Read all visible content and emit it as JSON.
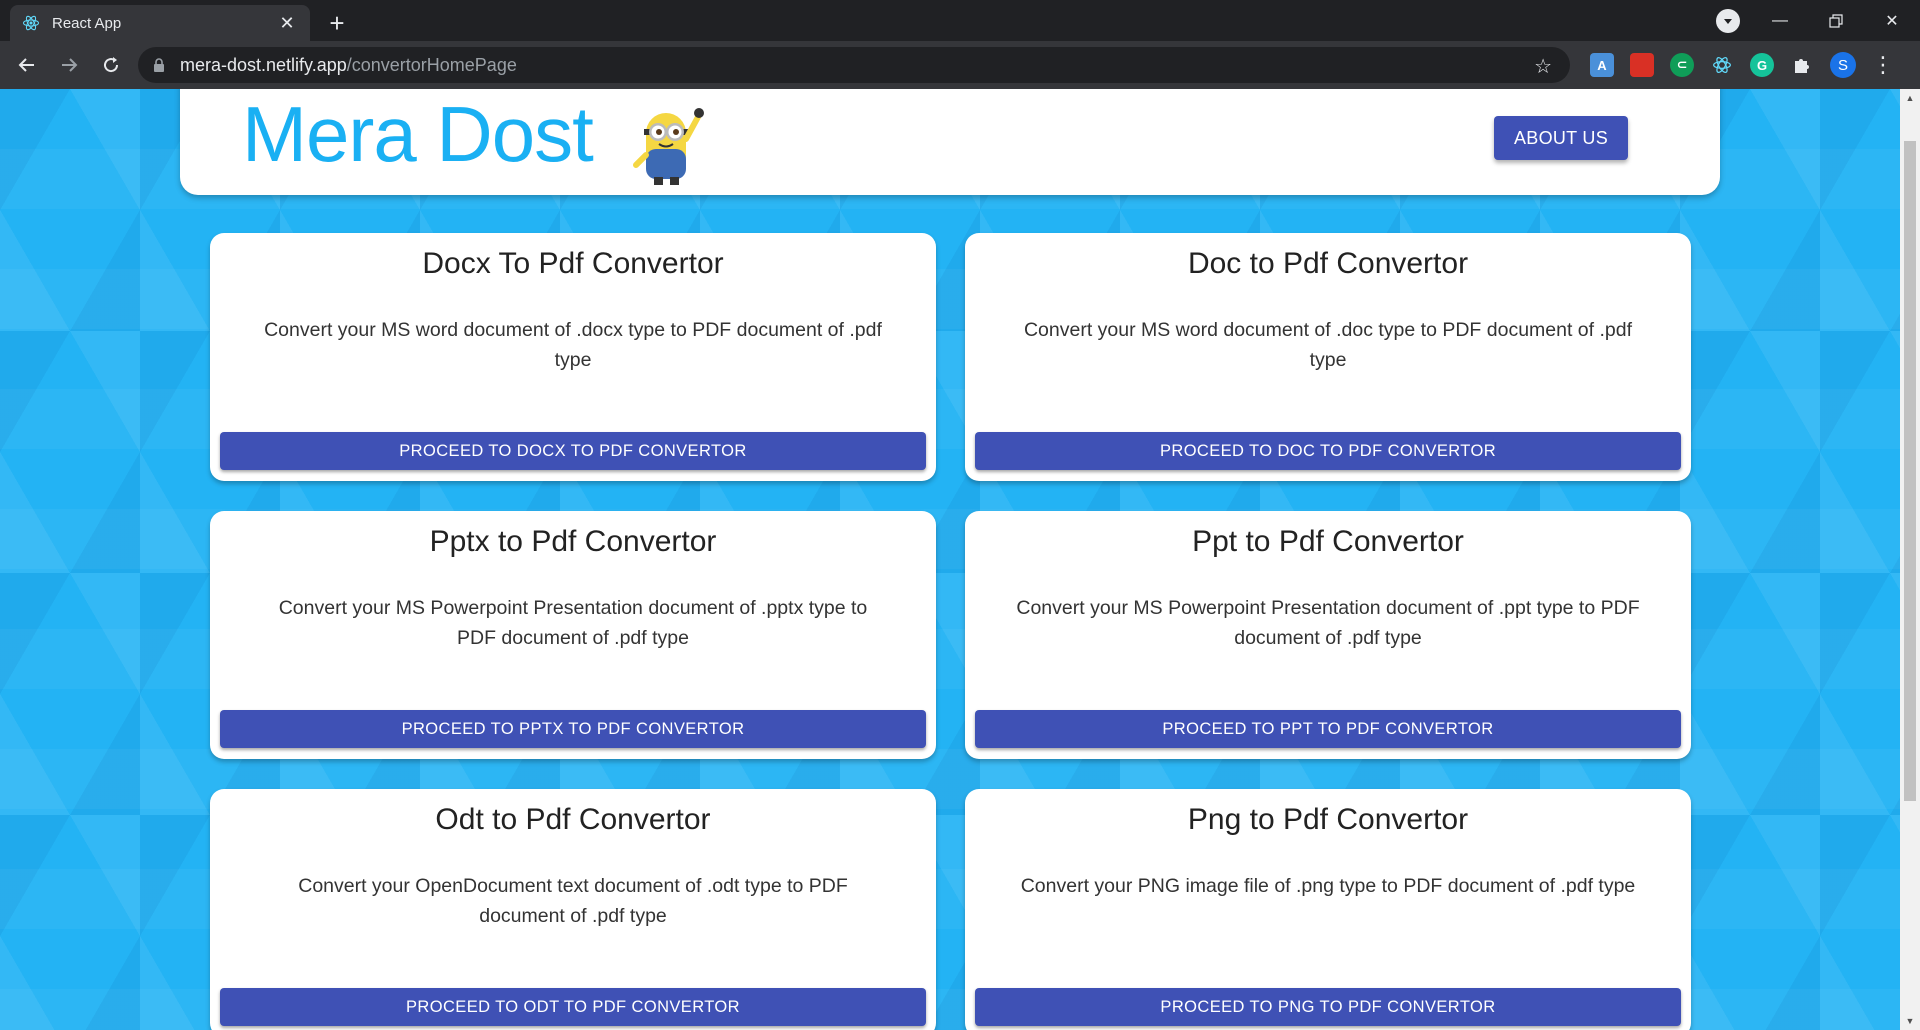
{
  "browser": {
    "tab_title": "React App",
    "new_tab_symbol": "+",
    "url_host": "mera-dost.netlify.app",
    "url_path": "/convertorHomePage",
    "profile_initial": "S"
  },
  "header": {
    "brand": "Mera Dost",
    "about_label": "ABOUT US"
  },
  "cards": [
    {
      "title": "Docx To Pdf Convertor",
      "description": "Convert your MS word document of .docx type to PDF document of .pdf type",
      "button": "PROCEED TO DOCX TO PDF CONVERTOR"
    },
    {
      "title": "Doc to Pdf Convertor",
      "description": "Convert your MS word document of .doc type to PDF document of .pdf type",
      "button": "PROCEED TO DOC TO PDF CONVERTOR"
    },
    {
      "title": "Pptx to Pdf Convertor",
      "description": "Convert your MS Powerpoint Presentation document of .pptx type to PDF document of .pdf type",
      "button": "PROCEED TO PPTX TO PDF CONVERTOR"
    },
    {
      "title": "Ppt to Pdf Convertor",
      "description": "Convert your MS Powerpoint Presentation document of .ppt type to PDF document of .pdf type",
      "button": "PROCEED TO PPT TO PDF CONVERTOR"
    },
    {
      "title": "Odt to Pdf Convertor",
      "description": "Convert your OpenDocument text document of .odt type to PDF document of .pdf type",
      "button": "PROCEED TO ODT TO PDF CONVERTOR"
    },
    {
      "title": "Png to Pdf Convertor",
      "description": "Convert your PNG image file of .png type to PDF document of .pdf type",
      "button": "PROCEED TO PNG TO PDF CONVERTOR"
    }
  ],
  "colors": {
    "brand": "#1ab0f3",
    "button": "#3f51b5",
    "page_background": "#23b3f4"
  }
}
